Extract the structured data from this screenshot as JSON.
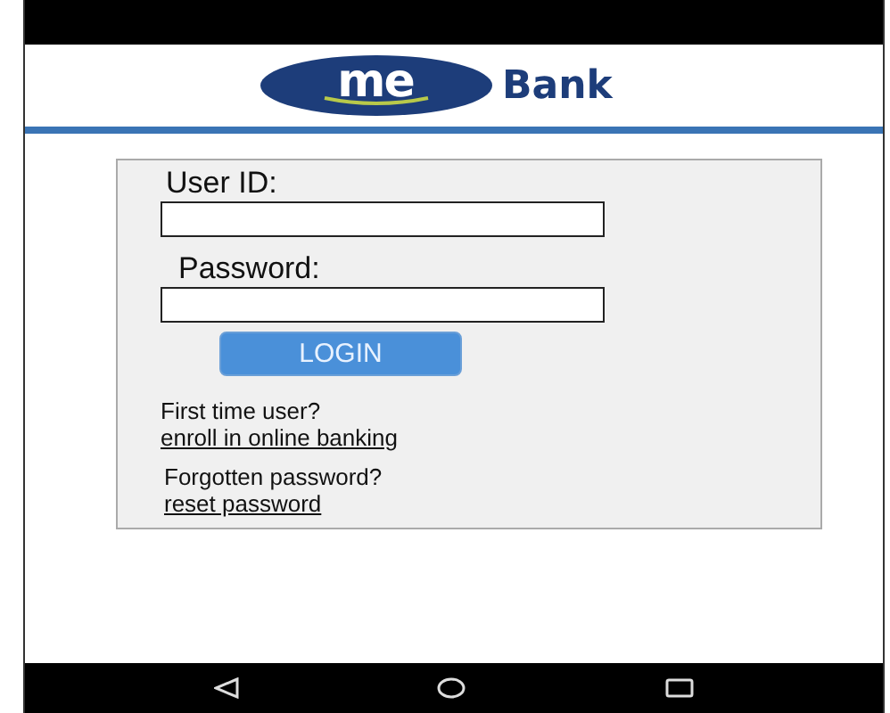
{
  "logo": {
    "mark": "me",
    "name": "Bank"
  },
  "form": {
    "user_id_label": "User ID:",
    "password_label": "Password:",
    "login_button": "LOGIN",
    "first_time": "First time user?",
    "enroll_link": "enroll in online banking",
    "forgotten": "Forgotten password?",
    "reset_link": "reset password"
  }
}
